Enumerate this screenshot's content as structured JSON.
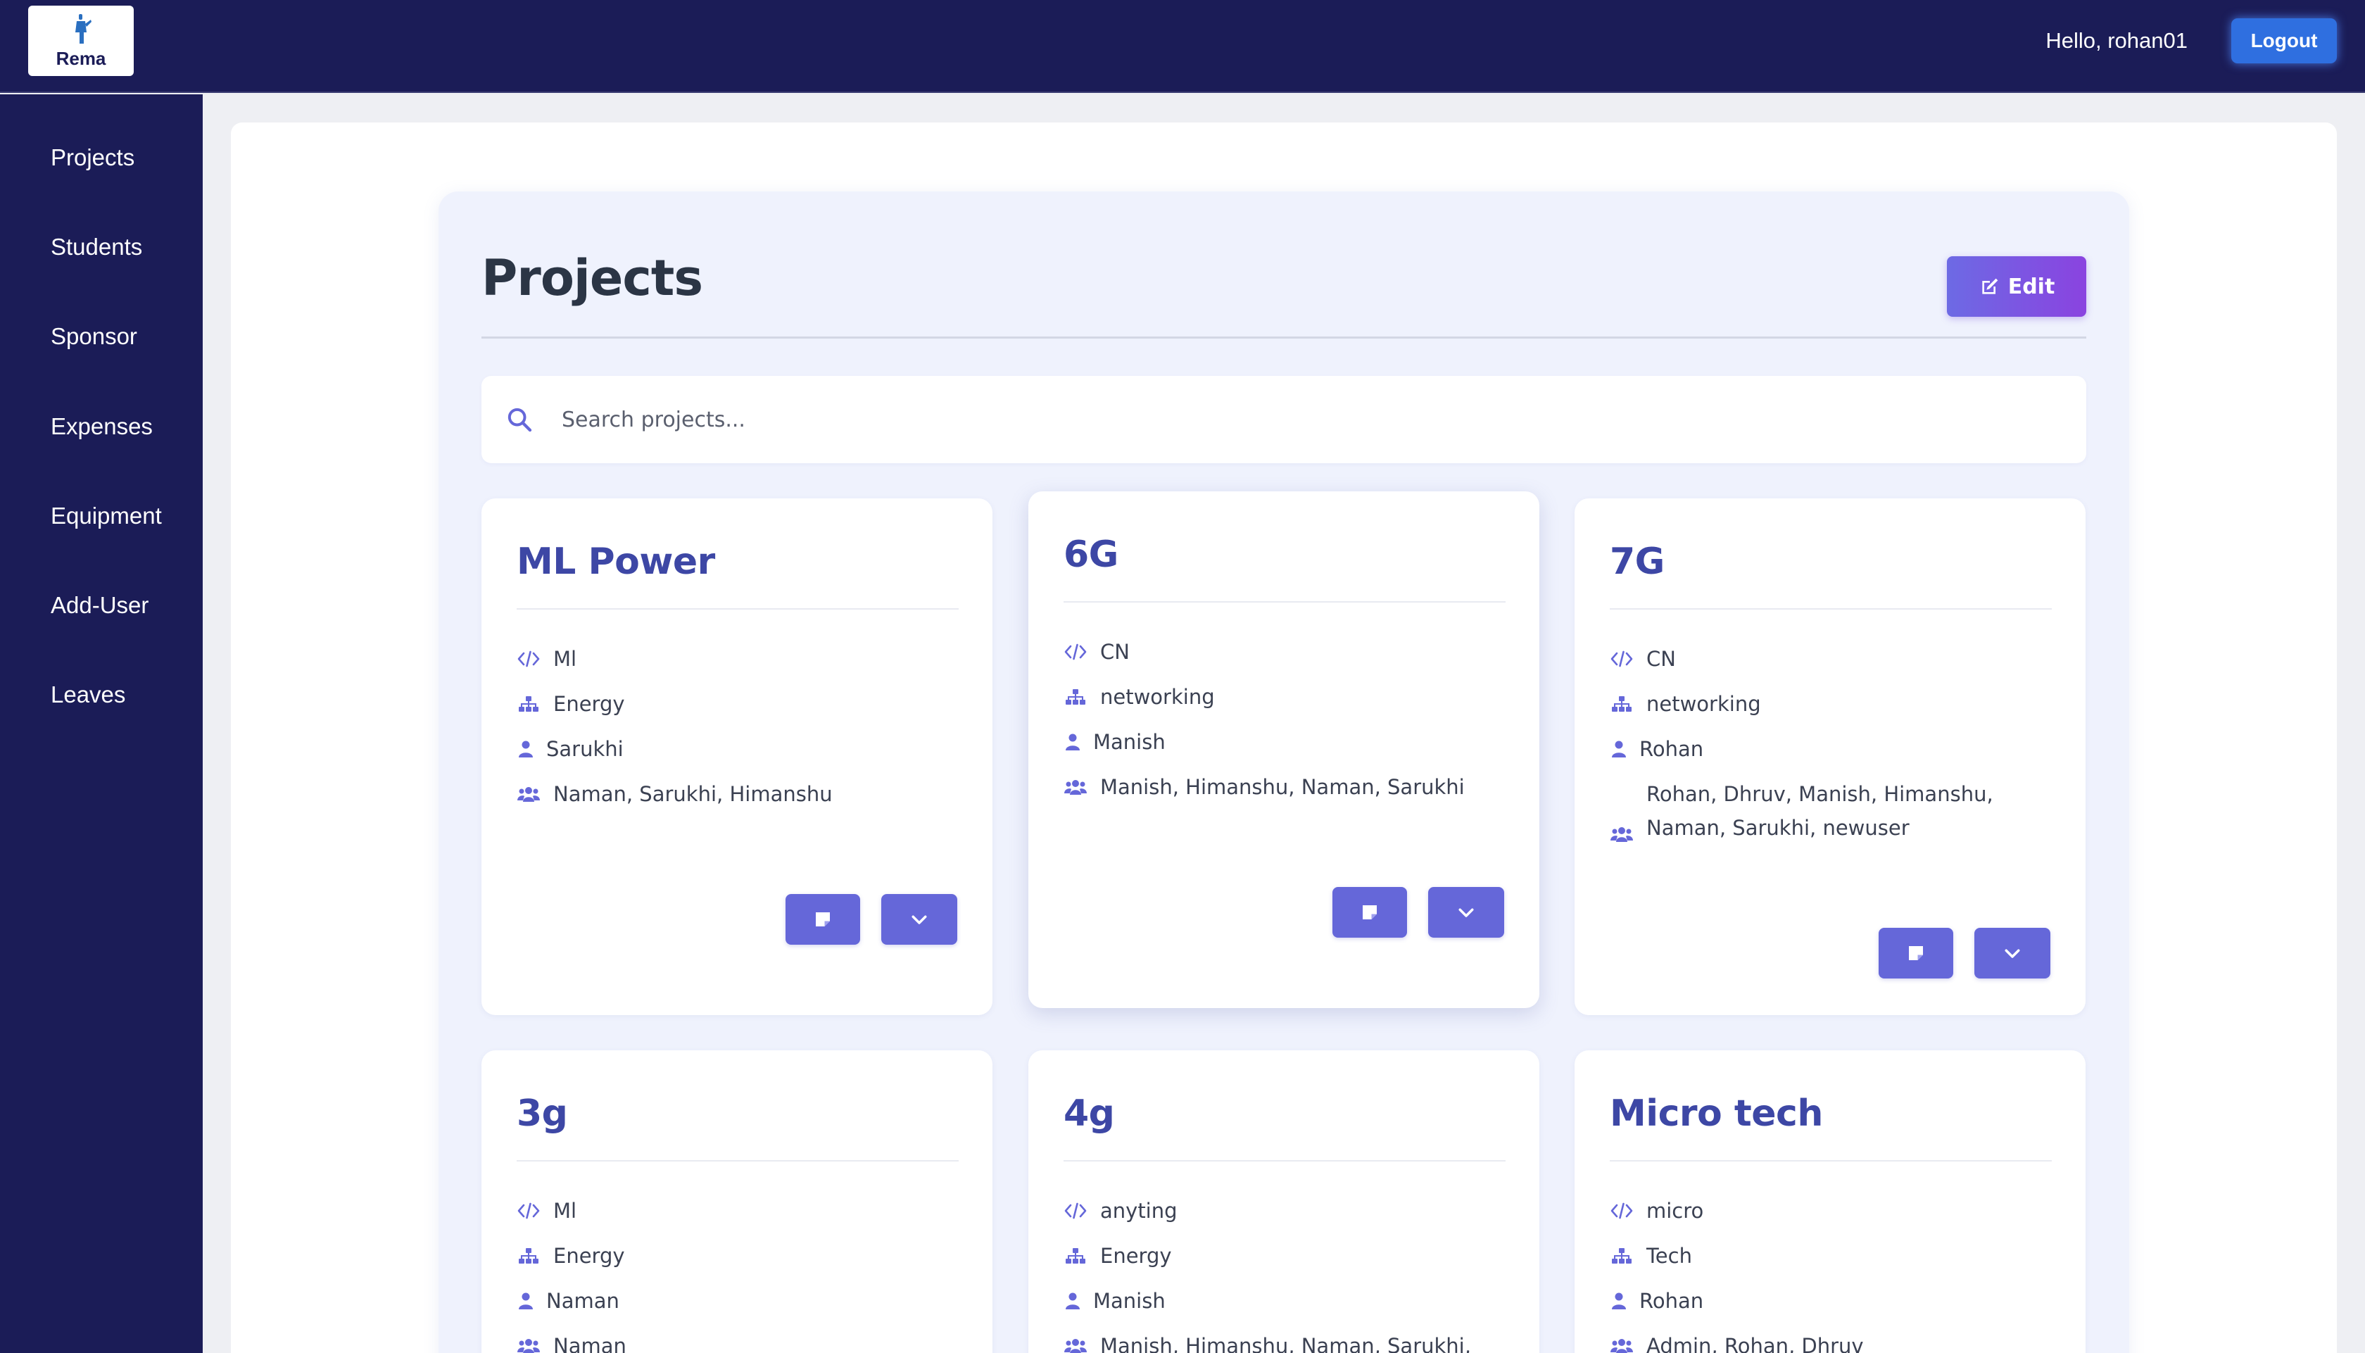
{
  "header": {
    "logo_text": "Rema",
    "greeting": "Hello, rohan01",
    "logout_label": "Logout"
  },
  "sidebar": {
    "items": [
      {
        "label": "Projects"
      },
      {
        "label": "Students"
      },
      {
        "label": "Sponsor"
      },
      {
        "label": "Expenses"
      },
      {
        "label": "Equipment"
      },
      {
        "label": "Add-User"
      },
      {
        "label": "Leaves"
      }
    ]
  },
  "main": {
    "title": "Projects",
    "edit_label": "Edit",
    "search": {
      "placeholder": "Search projects...",
      "value": ""
    }
  },
  "projects": [
    {
      "name": "ML Power",
      "domain": "Ml",
      "category": "Energy",
      "lead": "Sarukhi",
      "members": "Naman, Sarukhi, Himanshu"
    },
    {
      "name": "6G",
      "domain": "CN",
      "category": "networking",
      "lead": "Manish",
      "members": "Manish, Himanshu, Naman, Sarukhi"
    },
    {
      "name": "7G",
      "domain": "CN",
      "category": "networking",
      "lead": "Rohan",
      "members": "Rohan, Dhruv, Manish, Himanshu, Naman, Sarukhi, newuser"
    },
    {
      "name": "3g",
      "domain": "Ml",
      "category": "Energy",
      "lead": "Naman",
      "members": "Naman"
    },
    {
      "name": "4g",
      "domain": "anyting",
      "category": "Energy",
      "lead": "Manish",
      "members": "Manish, Himanshu, Naman, Sarukhi,"
    },
    {
      "name": "Micro tech",
      "domain": "micro",
      "category": "Tech",
      "lead": "Rohan",
      "members": "Admin, Rohan, Dhruv"
    }
  ],
  "colors": {
    "nav_bg": "#1b1c57",
    "accent": "#6567d9",
    "title_color": "#3d47a5",
    "logout_bg": "#2f6fe0"
  },
  "icons": {
    "domain": "code-icon",
    "category": "sitemap-icon",
    "lead": "user-icon",
    "members": "users-icon",
    "note": "note-icon",
    "expand": "chevron-down-icon",
    "search": "search-icon",
    "edit": "edit-icon"
  }
}
